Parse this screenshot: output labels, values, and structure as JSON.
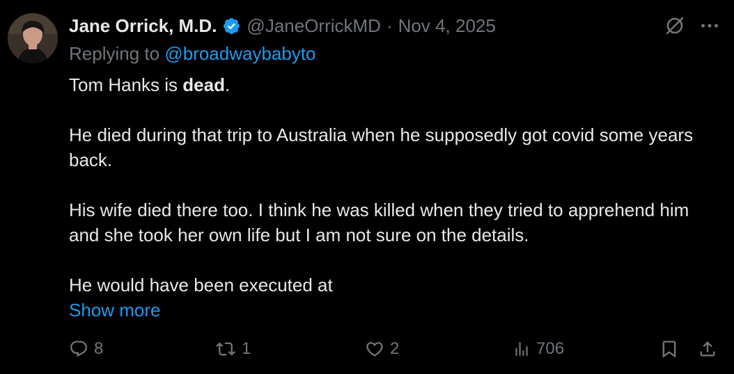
{
  "tweet": {
    "display_name": "Jane Orrick, M.D.",
    "handle": "@JaneOrrickMD",
    "separator": "·",
    "date": "Nov 4, 2025",
    "replying_prefix": "Replying to ",
    "replying_to": "@broadwaybabyto",
    "line1_prefix": "Tom Hanks is ",
    "line1_bold": "dead",
    "line1_suffix": ".",
    "paragraph2": "He died during that trip to Australia when he supposedly got covid some years back.",
    "paragraph3": "His wife died there too.  I think he was killed when they tried to apprehend him and she took her own life but I am not sure on the details.",
    "paragraph4": "He would have been executed at",
    "show_more": "Show more"
  },
  "actions": {
    "replies": "8",
    "reposts": "1",
    "likes": "2",
    "views": "706"
  },
  "icons": {
    "verified": "verified-badge-icon",
    "grok": "grok-icon",
    "more": "more-icon",
    "reply": "reply-icon",
    "repost": "repost-icon",
    "like": "heart-icon",
    "views": "views-icon",
    "bookmark": "bookmark-icon",
    "share": "share-icon"
  },
  "colors": {
    "background": "#000000",
    "text": "#e7e9ea",
    "muted": "#71767b",
    "link": "#1d9bf0"
  }
}
